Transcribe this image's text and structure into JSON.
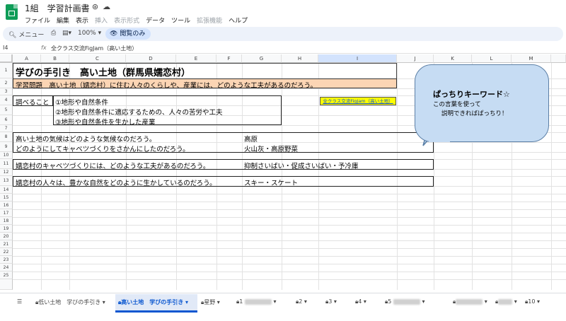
{
  "window": {
    "doc_title": "1組　学習計画書",
    "title_icons": [
      "star-icon",
      "move-icon",
      "cloud-icon"
    ]
  },
  "menu": [
    "ファイル",
    "編集",
    "表示",
    "挿入",
    "表示形式",
    "データ",
    "ツール",
    "拡張機能",
    "ヘルプ"
  ],
  "toolbar": {
    "menu_label": "メニュー",
    "zoom": "100%",
    "view_only": "閲覧のみ"
  },
  "formula_bar": {
    "cell_ref": "I4",
    "fx": "fx",
    "value": "全クラス交流FigJam（高い土地）"
  },
  "columns": [
    "A",
    "B",
    "C",
    "D",
    "E",
    "F",
    "G",
    "H",
    "I",
    "J",
    "K",
    "L",
    "M"
  ],
  "rows": [
    "1",
    "2",
    "3",
    "4",
    "5",
    "6",
    "7",
    "8",
    "9",
    "10",
    "11",
    "12",
    "13",
    "14",
    "15",
    "16",
    "17",
    "18",
    "19",
    "20",
    "21",
    "22",
    "23",
    "24",
    "25"
  ],
  "sheet": {
    "title": "学びの手引き　高い土地（群馬県嬬恋村）",
    "question_label": "学習問題",
    "question": "高い土地（嬬恋村）に住む人々のくらしや、産業には、どのような工夫があるのだろう。",
    "investigate_label": "調べること",
    "investigate_items": [
      "①地形や自然条件",
      "②地形や自然条件に適応するための、人々の苦労や工夫",
      "③地形や自然条件を生かした産業"
    ],
    "link_button": "全クラス交流FigJam（高い土地）",
    "q1": "高い土地の気候はどのような気候なのだろう。",
    "a1": "高原",
    "q2": "どのようにしてキャベツづくりをさかんにしたのだろう。",
    "a2": "火山灰・高原野菜",
    "q3": "嬬恋村のキャベツづくりには、どのような工夫があるのだろう。",
    "a3": "抑制さいばい・促成さいばい・予冷庫",
    "q4": "嬬恋村の人々は、豊かな自然をどのように生かしているのだろう。",
    "a4": "スキー・スケート"
  },
  "callout": {
    "title": "ぱっちりキーワード☆",
    "line1": "この言葉を使って",
    "line2": "説明できればぱっちり！"
  },
  "tabs": [
    {
      "label": "低い土地　学びの手引き",
      "locked": true
    },
    {
      "label": "高い土地　学びの手引き",
      "locked": true,
      "active": true
    },
    {
      "label": "星野",
      "locked": true
    },
    {
      "label": "1",
      "locked": true
    },
    {
      "label": "2",
      "locked": true
    },
    {
      "label": "3",
      "locked": true
    },
    {
      "label": "4",
      "locked": true
    },
    {
      "label": "5",
      "locked": true
    },
    {
      "label": "10",
      "locked": true
    }
  ]
}
